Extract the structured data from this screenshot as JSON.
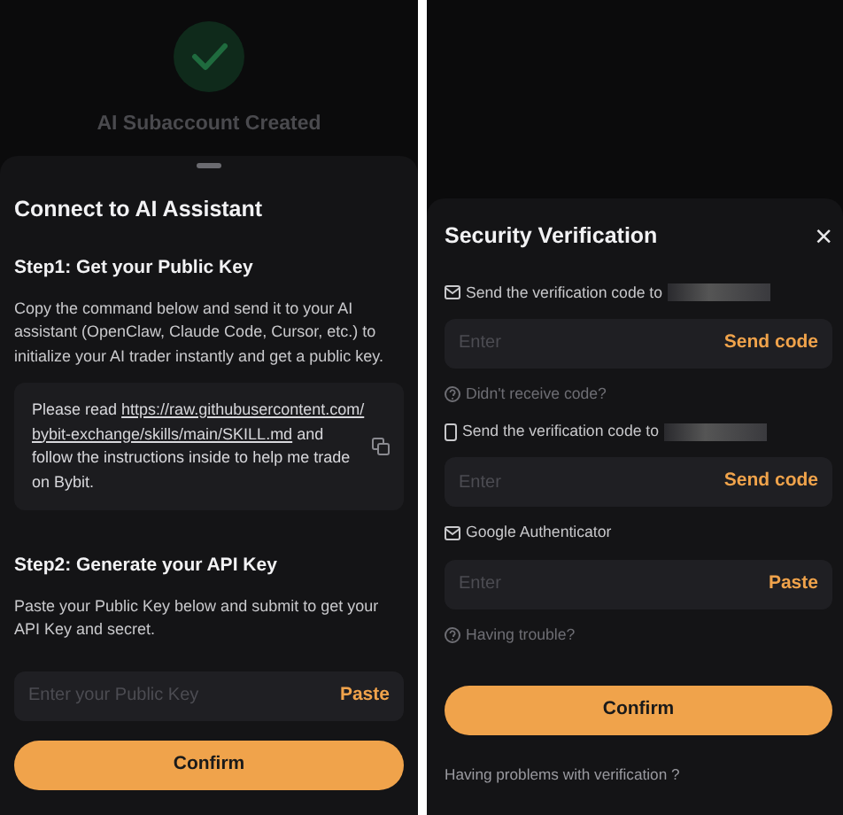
{
  "left_screen": {
    "background_title": "AI Subaccount Created",
    "sheet": {
      "title": "Connect to AI Assistant",
      "step1_title": "Step1: Get your Public Key",
      "step1_text": "Copy the command below and send it to your AI assistant (OpenClaw, Claude Code, Cursor, etc.) to initialize your AI trader instantly and get a public key.",
      "command": {
        "prefix": "Please read ",
        "link": "https://raw.githubusercontent.com/bybit-exchange/skills/main/SKILL.md",
        "suffix": " and follow the instructions inside to help me trade on Bybit."
      },
      "step2_title": "Step2: Generate your API Key",
      "step2_text": "Paste your Public Key below and submit to get your API Key and secret.",
      "public_key_field": {
        "placeholder": "Enter your Public Key",
        "action": "Paste"
      },
      "confirm": "Confirm"
    }
  },
  "right_screen": {
    "title": "Security Verification",
    "close": "×",
    "fields": [
      {
        "kind": "email",
        "label": "Send the verification code to",
        "redacted": true,
        "placeholder": "Enter",
        "action": "Send code",
        "hint": "Didn't receive code?"
      },
      {
        "kind": "phone",
        "label": "Send the verification code to",
        "redacted": true,
        "placeholder": "Enter",
        "action": "Send code"
      },
      {
        "kind": "authenticator",
        "label": "Google Authenticator",
        "redacted": false,
        "placeholder": "Enter",
        "action": "Paste",
        "hint": "Having trouble?"
      }
    ],
    "confirm": "Confirm",
    "footer": "Having problems with verification ?"
  }
}
